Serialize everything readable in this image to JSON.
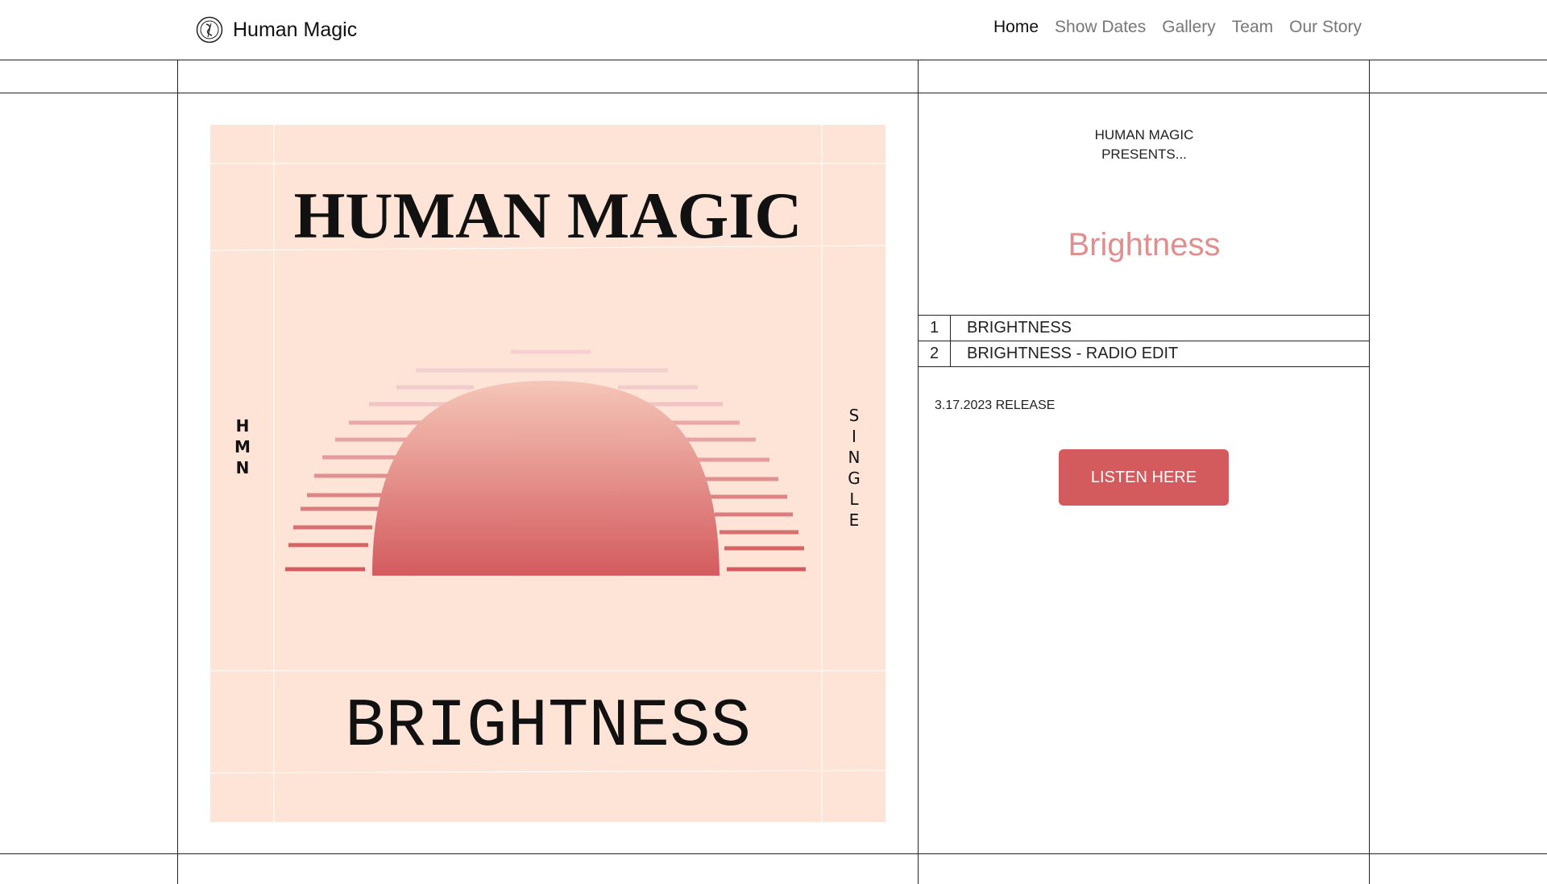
{
  "header": {
    "brand_name": "Human Magic",
    "nav": [
      {
        "label": "Home"
      },
      {
        "label": "Show Dates"
      },
      {
        "label": "Gallery"
      },
      {
        "label": "Team"
      },
      {
        "label": "Our Story"
      }
    ],
    "active_nav": "Home"
  },
  "album_art": {
    "band_name": "HUMAN MAGIC",
    "title": "BRIGHTNESS",
    "side_left": [
      "H",
      "M",
      "N"
    ],
    "side_right": [
      "S",
      "I",
      "N",
      "G",
      "L",
      "E"
    ],
    "colors": {
      "background": "#fde4d6",
      "sun_top": "#f5c6b8",
      "sun_bottom": "#d35b5e"
    }
  },
  "release": {
    "presents_line1": "HUMAN MAGIC",
    "presents_line2": "PRESENTS...",
    "title": "Brightness",
    "tracks": [
      {
        "number": "1",
        "title": "BRIGHTNESS"
      },
      {
        "number": "2",
        "title": "BRIGHTNESS - RADIO EDIT"
      }
    ],
    "release_date": "3.17.2023 RELEASE",
    "listen_button": "LISTEN HERE"
  },
  "colors": {
    "accent": "#d35b5e",
    "title_pink": "#e08e8e",
    "nav_inactive": "#777777"
  }
}
